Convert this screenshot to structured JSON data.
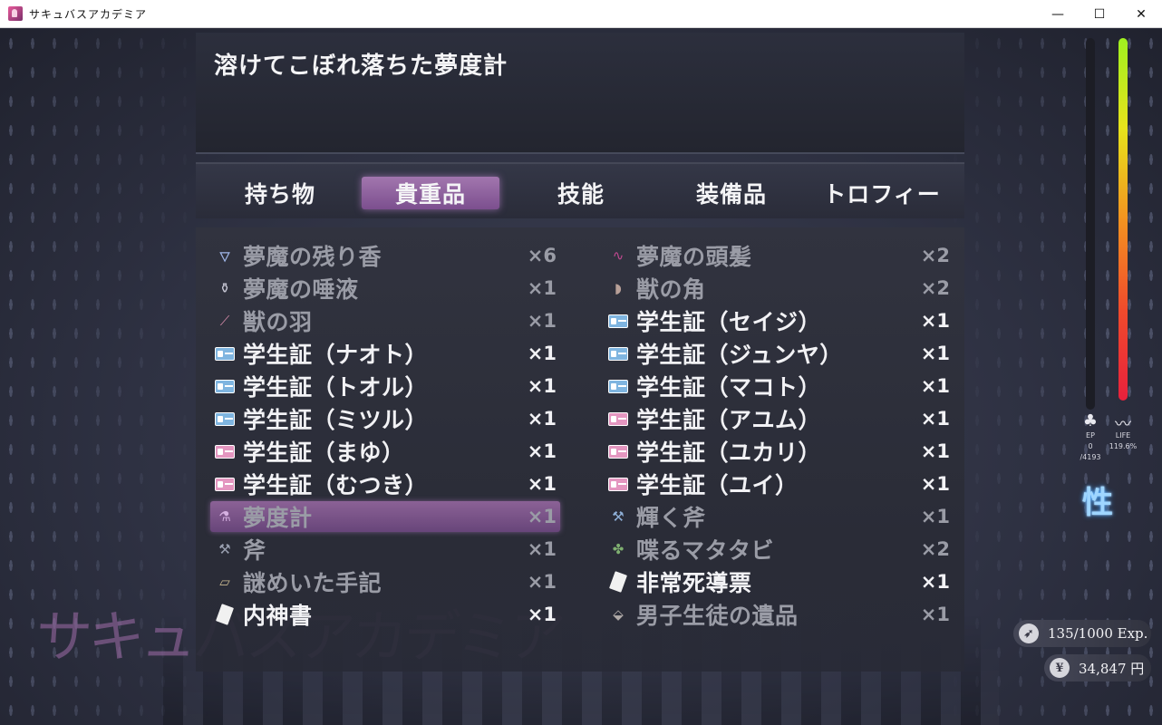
{
  "window": {
    "title": "サキュバスアカデミア",
    "minimize": "—",
    "maximize": "☐",
    "close": "✕"
  },
  "help": {
    "text": "溶けてこぼれ落ちた夢度計"
  },
  "tabs": [
    {
      "label": "持ち物",
      "active": false
    },
    {
      "label": "貴重品",
      "active": true
    },
    {
      "label": "技能",
      "active": false
    },
    {
      "label": "装備品",
      "active": false
    },
    {
      "label": "トロフィー",
      "active": false
    }
  ],
  "items_left": [
    {
      "name": "夢魔の残り香",
      "count": "×6",
      "icon": "perfume-bottle-icon",
      "glyph": "🜄",
      "bright": false,
      "color": "#9fb6e8"
    },
    {
      "name": "夢魔の唾液",
      "count": "×1",
      "icon": "flask-icon",
      "glyph": "⚱",
      "bright": false,
      "color": "#c9c9d6"
    },
    {
      "name": "獣の羽",
      "count": "×1",
      "icon": "feather-icon",
      "glyph": "⟋",
      "bright": false,
      "color": "#d48aa8"
    },
    {
      "name": "学生証（ナオト）",
      "count": "×1",
      "icon": "student-id-card-icon",
      "card": "blue",
      "bright": true
    },
    {
      "name": "学生証（トオル）",
      "count": "×1",
      "icon": "student-id-card-icon",
      "card": "blue",
      "bright": true
    },
    {
      "name": "学生証（ミツル）",
      "count": "×1",
      "icon": "student-id-card-icon",
      "card": "blue",
      "bright": true
    },
    {
      "name": "学生証（まゆ）",
      "count": "×1",
      "icon": "student-id-card-icon",
      "card": "pink",
      "bright": true
    },
    {
      "name": "学生証（むつき）",
      "count": "×1",
      "icon": "student-id-card-icon",
      "card": "pink",
      "bright": true
    },
    {
      "name": "夢度計",
      "count": "×1",
      "icon": "dream-meter-jar-icon",
      "glyph": "⚗",
      "bright": false,
      "selected": true,
      "color": "#d6b1e2"
    },
    {
      "name": "斧",
      "count": "×1",
      "icon": "axe-icon",
      "glyph": "⚒",
      "bright": false,
      "color": "#9aa0b0"
    },
    {
      "name": "謎めいた手記",
      "count": "×1",
      "icon": "notebook-icon",
      "glyph": "▱",
      "bright": false,
      "color": "#c8b890"
    },
    {
      "name": "内神書",
      "count": "×1",
      "icon": "paper-icon",
      "paper": true,
      "bright": true
    }
  ],
  "items_right": [
    {
      "name": "夢魔の頭髪",
      "count": "×2",
      "icon": "hair-strand-icon",
      "glyph": "∿",
      "bright": false,
      "color": "#c04890"
    },
    {
      "name": "獣の角",
      "count": "×2",
      "icon": "horn-icon",
      "glyph": "◗",
      "bright": false,
      "color": "#b8a098"
    },
    {
      "name": "学生証（セイジ）",
      "count": "×1",
      "icon": "student-id-card-icon",
      "card": "blue",
      "bright": true
    },
    {
      "name": "学生証（ジュンヤ）",
      "count": "×1",
      "icon": "student-id-card-icon",
      "card": "blue",
      "bright": true
    },
    {
      "name": "学生証（マコト）",
      "count": "×1",
      "icon": "student-id-card-icon",
      "card": "blue",
      "bright": true
    },
    {
      "name": "学生証（アユム）",
      "count": "×1",
      "icon": "student-id-card-icon",
      "card": "pink",
      "bright": true
    },
    {
      "name": "学生証（ユカリ）",
      "count": "×1",
      "icon": "student-id-card-icon",
      "card": "pink",
      "bright": true
    },
    {
      "name": "学生証（ユイ）",
      "count": "×1",
      "icon": "student-id-card-icon",
      "card": "pink",
      "bright": true
    },
    {
      "name": "輝く斧",
      "count": "×1",
      "icon": "shining-axe-icon",
      "glyph": "⚒",
      "bright": false,
      "color": "#8fb0d8"
    },
    {
      "name": "喋るマタタビ",
      "count": "×2",
      "icon": "plant-icon",
      "glyph": "✤",
      "bright": false,
      "color": "#7fb070"
    },
    {
      "name": "非常死導票",
      "count": "×1",
      "icon": "paper-icon",
      "paper": true,
      "bright": true
    },
    {
      "name": "男子生徒の遺品",
      "count": "×1",
      "icon": "box-icon",
      "glyph": "⬙",
      "bright": false,
      "color": "#b0aaa8"
    }
  ],
  "status": {
    "ep_label": "EP",
    "ep_value": "0",
    "ep_max": "/4193",
    "life_label": "LIFE",
    "life_value": "119.6%",
    "badge": "性",
    "exp": "135/1000 Exp.",
    "money": "34,847 円",
    "yen_symbol": "¥"
  },
  "logo": "サキュバスアカデミア",
  "colors": {
    "selected": "#b478be",
    "text": "#f2f2f5",
    "dim": "#9a9ca6"
  }
}
